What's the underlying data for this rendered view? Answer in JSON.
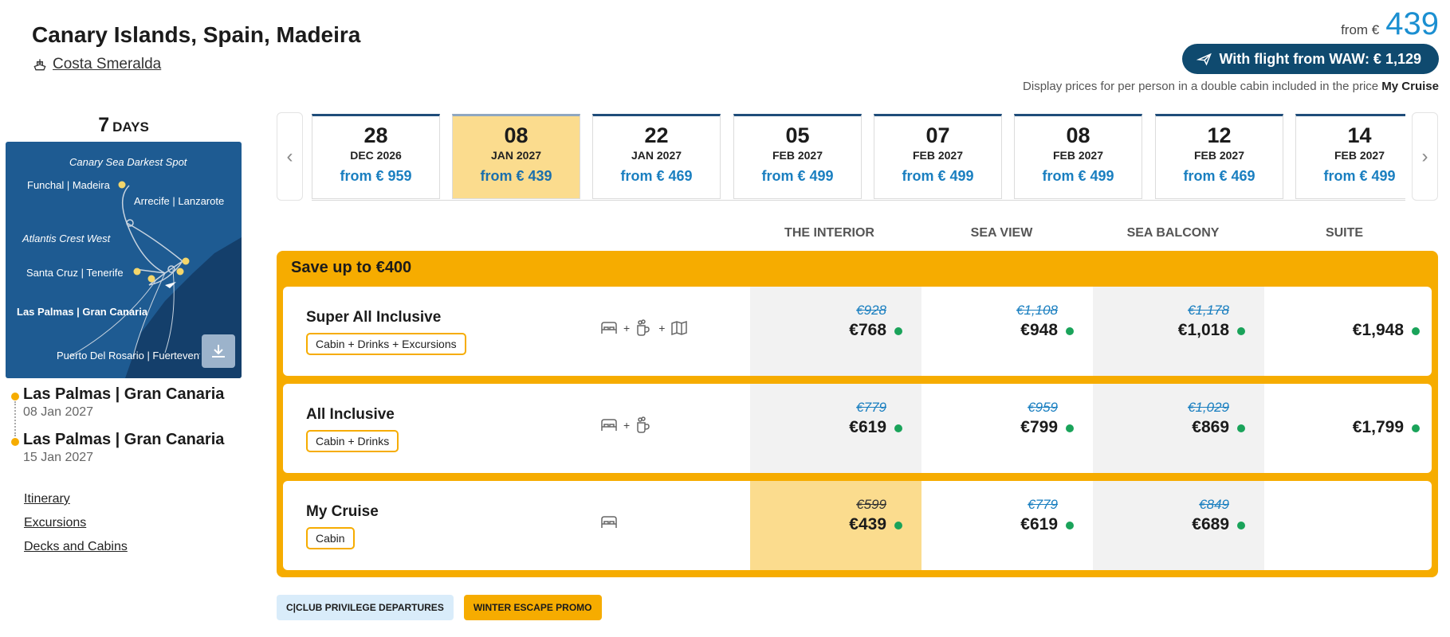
{
  "header": {
    "title": "Canary Islands, Spain, Madeira",
    "ship_name": "Costa Smeralda",
    "from_label": "from €",
    "from_price": "439",
    "flight_button": "With flight from WAW: € 1,129",
    "display_note_prefix": "Display prices for per person in a double cabin included in the price",
    "display_note_bold": "My Cruise"
  },
  "left": {
    "days_number": "7",
    "days_unit": "DAYS",
    "map_labels": {
      "l1": "Canary Sea Darkest Spot",
      "l2": "Funchal | Madeira",
      "l3": "Arrecife | Lanzarote",
      "l4": "Atlantis Crest West",
      "l5": "Santa Cruz | Tenerife",
      "l6": "Las Palmas | Gran Canaria",
      "l7": "Puerto Del Rosario | Fuerteventura"
    },
    "ports": [
      {
        "name": "Las Palmas | Gran Canaria",
        "date": "08 Jan 2027"
      },
      {
        "name": "Las Palmas | Gran Canaria",
        "date": "15 Jan 2027"
      }
    ],
    "links": [
      "Itinerary",
      "Excursions",
      "Decks and Cabins"
    ]
  },
  "dates": [
    {
      "day": "28",
      "month": "DEC 2026",
      "price": "from € 959"
    },
    {
      "day": "08",
      "month": "JAN 2027",
      "price": "from € 439",
      "selected": true
    },
    {
      "day": "22",
      "month": "JAN 2027",
      "price": "from € 469"
    },
    {
      "day": "05",
      "month": "FEB 2027",
      "price": "from € 499"
    },
    {
      "day": "07",
      "month": "FEB 2027",
      "price": "from € 499"
    },
    {
      "day": "08",
      "month": "FEB 2027",
      "price": "from € 499"
    },
    {
      "day": "12",
      "month": "FEB 2027",
      "price": "from € 469"
    },
    {
      "day": "14",
      "month": "FEB 2027",
      "price": "from € 499"
    }
  ],
  "columns": [
    "THE INTERIOR",
    "SEA VIEW",
    "SEA BALCONY",
    "SUITE"
  ],
  "promo": {
    "title": "Save up to €400",
    "fares": [
      {
        "name": "Super All Inclusive",
        "tag": "Cabin + Drinks + Excursions",
        "amenities": [
          "bed-icon",
          "drink-icon",
          "map-icon"
        ],
        "prices": [
          {
            "old": "€928",
            "new": "€768"
          },
          {
            "old": "€1,108",
            "new": "€948"
          },
          {
            "old": "€1,178",
            "new": "€1,018"
          },
          {
            "old": "",
            "new": "€1,948"
          }
        ]
      },
      {
        "name": "All Inclusive",
        "tag": "Cabin + Drinks",
        "amenities": [
          "bed-icon",
          "drink-icon"
        ],
        "prices": [
          {
            "old": "€779",
            "new": "€619"
          },
          {
            "old": "€959",
            "new": "€799"
          },
          {
            "old": "€1,029",
            "new": "€869"
          },
          {
            "old": "",
            "new": "€1,799"
          }
        ]
      },
      {
        "name": "My Cruise",
        "tag": "Cabin",
        "amenities": [
          "bed-icon"
        ],
        "prices": [
          {
            "old": "€599",
            "new": "€439"
          },
          {
            "old": "€779",
            "new": "€619"
          },
          {
            "old": "€849",
            "new": "€689"
          },
          {
            "old": "",
            "new": ""
          }
        ]
      }
    ]
  },
  "badges": [
    "C|CLUB PRIVILEGE DEPARTURES",
    "WINTER ESCAPE PROMO"
  ],
  "colors": {
    "accent_yellow": "#f6ac00",
    "selected_gold": "#fbdc8e",
    "navy": "#0f4a6f",
    "price_blue": "#1a7fc0",
    "available_green": "#1aa35a"
  }
}
